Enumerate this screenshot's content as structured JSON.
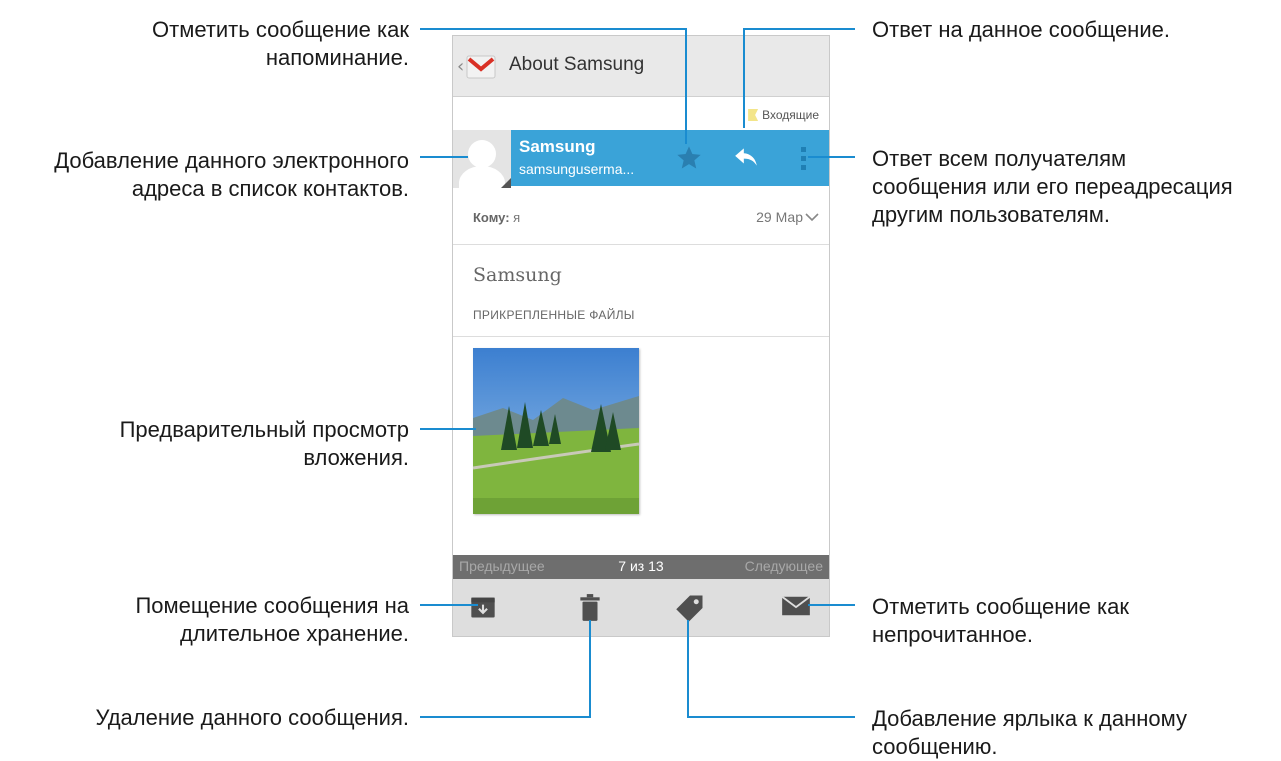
{
  "appbar": {
    "title": "About Samsung",
    "back_icon": "chevron-left-icon",
    "logo_icon": "gmail-icon"
  },
  "folder": {
    "label": "Входящие"
  },
  "sender": {
    "name": "Samsung",
    "email": "samsunguserma...",
    "star_icon": "star-icon",
    "reply_icon": "reply-icon",
    "more_icon": "overflow-menu-icon"
  },
  "recipient": {
    "label": "Кому:",
    "value": "я",
    "date": "29 Мар"
  },
  "message": {
    "subject": "Samsung",
    "attachments_header": "ПРИКРЕПЛЕННЫЕ ФАЙЛЫ"
  },
  "pager": {
    "prev": "Предыдущее",
    "count": "7 из 13",
    "next": "Следующее"
  },
  "bottom_bar": {
    "icons": [
      "archive-icon",
      "trash-icon",
      "label-icon",
      "mark-unread-icon"
    ]
  },
  "callouts": {
    "star": [
      "Отметить сообщение как",
      "напоминание."
    ],
    "add_contact": [
      "Добавление данного электронного",
      "адреса в список контактов."
    ],
    "preview": [
      "Предварительный просмотр",
      "вложения."
    ],
    "archive": [
      "Помещение сообщения на",
      "длительное хранение."
    ],
    "delete": [
      "Удаление данного сообщения."
    ],
    "reply": [
      "Ответ на данное сообщение."
    ],
    "reply_all": [
      "Ответ всем получателям",
      "сообщения или его переадресация",
      "другим пользователям."
    ],
    "unread": [
      "Отметить сообщение как",
      "непрочитанное."
    ],
    "label": [
      "Добавление ярлыка к данному",
      "сообщению."
    ]
  },
  "colors": {
    "accent": "#3aa3d8",
    "leader": "#1a8cd0"
  }
}
